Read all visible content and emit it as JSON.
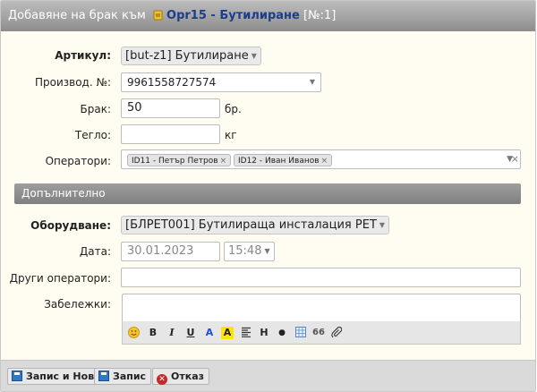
{
  "title": {
    "prefix": "Добавяне на брак към",
    "link": "Opr15 - Бутилиране",
    "suffix": "[№:1]"
  },
  "form": {
    "article": {
      "label": "Артикул:",
      "value": "[but-z1] Бутилиране"
    },
    "serial": {
      "label": "Производ. №:",
      "value": "9961558727574"
    },
    "defect": {
      "label": "Брак:",
      "value": "50",
      "unit": "бр."
    },
    "weight": {
      "label": "Тегло:",
      "value": "",
      "unit": "кг"
    },
    "operators": {
      "label": "Оператори:",
      "tags": [
        "ID11 - Петър Петров",
        "ID12 - Иван Иванов"
      ]
    }
  },
  "extra_section": {
    "title": "Допълнително",
    "equipment": {
      "label": "Оборудване:",
      "value": "[БЛРЕТ001] Бутилираща инсталация PET"
    },
    "date": {
      "label": "Дата:",
      "value": "30.01.2023",
      "time": "15:48"
    },
    "other_operators": {
      "label": "Други оператори:",
      "value": ""
    },
    "notes": {
      "label": "Забележки:",
      "value": ""
    }
  },
  "toolbar": [
    "smiley-icon",
    "bold",
    "italic",
    "underline",
    "text-color",
    "highlight",
    "align",
    "heading",
    "bullet",
    "table-icon",
    "quote-icon",
    "attach-icon"
  ],
  "toolbar_labels": {
    "bold": "B",
    "italic": "I",
    "underline": "U",
    "text_color": "A",
    "highlight": "A",
    "heading": "H",
    "quote": "66"
  },
  "footer": {
    "save_new": "Запис и Нов",
    "save": "Запис",
    "cancel": "Отказ"
  },
  "colors": {
    "form_bg": "#fffdf1",
    "title_link": "#1c3d8a",
    "save_icon": "#2f78c4",
    "cancel_icon": "#c62828"
  }
}
